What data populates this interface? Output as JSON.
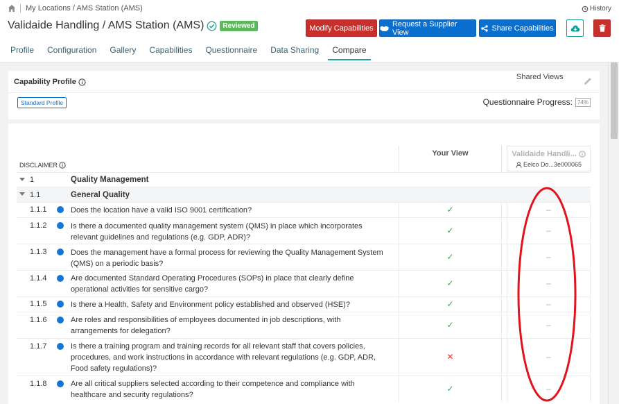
{
  "breadcrumb": {
    "path": "My Locations / AMS Station (AMS)"
  },
  "history_label": "History",
  "page_title": "Validaide Handling / AMS Station (AMS)",
  "status_badge": "Reviewed",
  "toolbar": {
    "modify_label": "Modify Capabilities",
    "request_label": "Request a Supplier View",
    "share_label": "Share Capabilities"
  },
  "tabs": [
    {
      "label": "Profile"
    },
    {
      "label": "Configuration"
    },
    {
      "label": "Gallery"
    },
    {
      "label": "Capabilities"
    },
    {
      "label": "Questionnaire"
    },
    {
      "label": "Data Sharing"
    },
    {
      "label": "Compare",
      "active": true
    }
  ],
  "profile": {
    "title": "Capability Profile",
    "standard_label": "Standard Profile",
    "progress_label": "Questionnaire Progress:",
    "progress_pct": "74%"
  },
  "compare": {
    "shared_views_label": "Shared Views",
    "your_view_label": "Your View",
    "shared_view_name": "Validaide Handli...",
    "shared_view_user": "Eelco Do...3e000065",
    "disclaimer_label": "DISCLAIMER"
  },
  "section": {
    "num": "1",
    "title": "Quality Management"
  },
  "subsection": {
    "num": "1.1",
    "title": "General Quality"
  },
  "questions": [
    {
      "num": "1.1.1",
      "text": "Does the location have a valid ISO 9001 certification?",
      "yours": "check",
      "shared": "dash"
    },
    {
      "num": "1.1.2",
      "text": "Is there a documented quality management system (QMS) in place which incorporates relevant guidelines and regulations (e.g. GDP, ADR)?",
      "yours": "check",
      "shared": "dash"
    },
    {
      "num": "1.1.3",
      "text": "Does the management have a formal process for reviewing the Quality Management System (QMS) on a periodic basis?",
      "yours": "check",
      "shared": "dash"
    },
    {
      "num": "1.1.4",
      "text": "Are documented Standard Operating Procedures (SOPs) in place that clearly define operational activities for sensitive cargo?",
      "yours": "check",
      "shared": "dash"
    },
    {
      "num": "1.1.5",
      "text": "Is there a Health, Safety and Environment policy established and observed (HSE)?",
      "yours": "check",
      "shared": "dash"
    },
    {
      "num": "1.1.6",
      "text": "Are roles and responsibilities of employees documented in job descriptions, with arrangements for delegation?",
      "yours": "check",
      "shared": "dash"
    },
    {
      "num": "1.1.7",
      "text": "Is there a training program and training records for all relevant staff that covers policies, procedures, and work instructions in accordance with relevant regulations (e.g. GDP, ADR, Food safety regulations)?",
      "yours": "cross",
      "shared": "dash"
    },
    {
      "num": "1.1.8",
      "text": "Are all critical suppliers selected according to their competence and compliance with healthcare and security regulations?",
      "yours": "check",
      "shared": "dash"
    }
  ],
  "colors": {
    "accent_teal": "#1aa39a",
    "modify_red": "#c9302c",
    "primary_blue": "#0a6fce",
    "reviewed_green": "#5cb85c",
    "annotation_red": "#e0141e"
  }
}
